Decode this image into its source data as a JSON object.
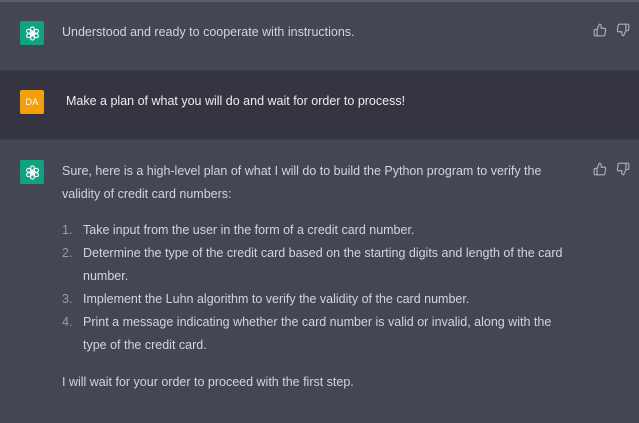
{
  "conversation": {
    "messages": [
      {
        "role": "assistant",
        "text": "Understood and ready to cooperate with instructions."
      },
      {
        "role": "user",
        "avatar_initials": "DA",
        "text": "Make a plan of what you will do and wait for order to process!"
      },
      {
        "role": "assistant",
        "intro": "Sure, here is a high-level plan of what I will do to build the Python program to verify the validity of credit card numbers:",
        "steps": [
          {
            "number": "1.",
            "text": "Take input from the user in the form of a credit card number."
          },
          {
            "number": "2.",
            "text": "Determine the type of the credit card based on the starting digits and length of the card number."
          },
          {
            "number": "3.",
            "text": "Implement the Luhn algorithm to verify the validity of the card number."
          },
          {
            "number": "4.",
            "text": "Print a message indicating whether the card number is valid or invalid, along with the type of the credit card."
          }
        ],
        "closing": "I will wait for your order to proceed with the first step."
      }
    ],
    "icons": {
      "assistant_avatar": "openai-logo-icon",
      "thumbs_up": "thumbs-up-icon",
      "thumbs_down": "thumbs-down-icon"
    },
    "colors": {
      "assistant_bg": "#444654",
      "user_bg": "#343541",
      "bot_avatar": "#10a37f",
      "user_avatar": "#f59e0b"
    }
  }
}
